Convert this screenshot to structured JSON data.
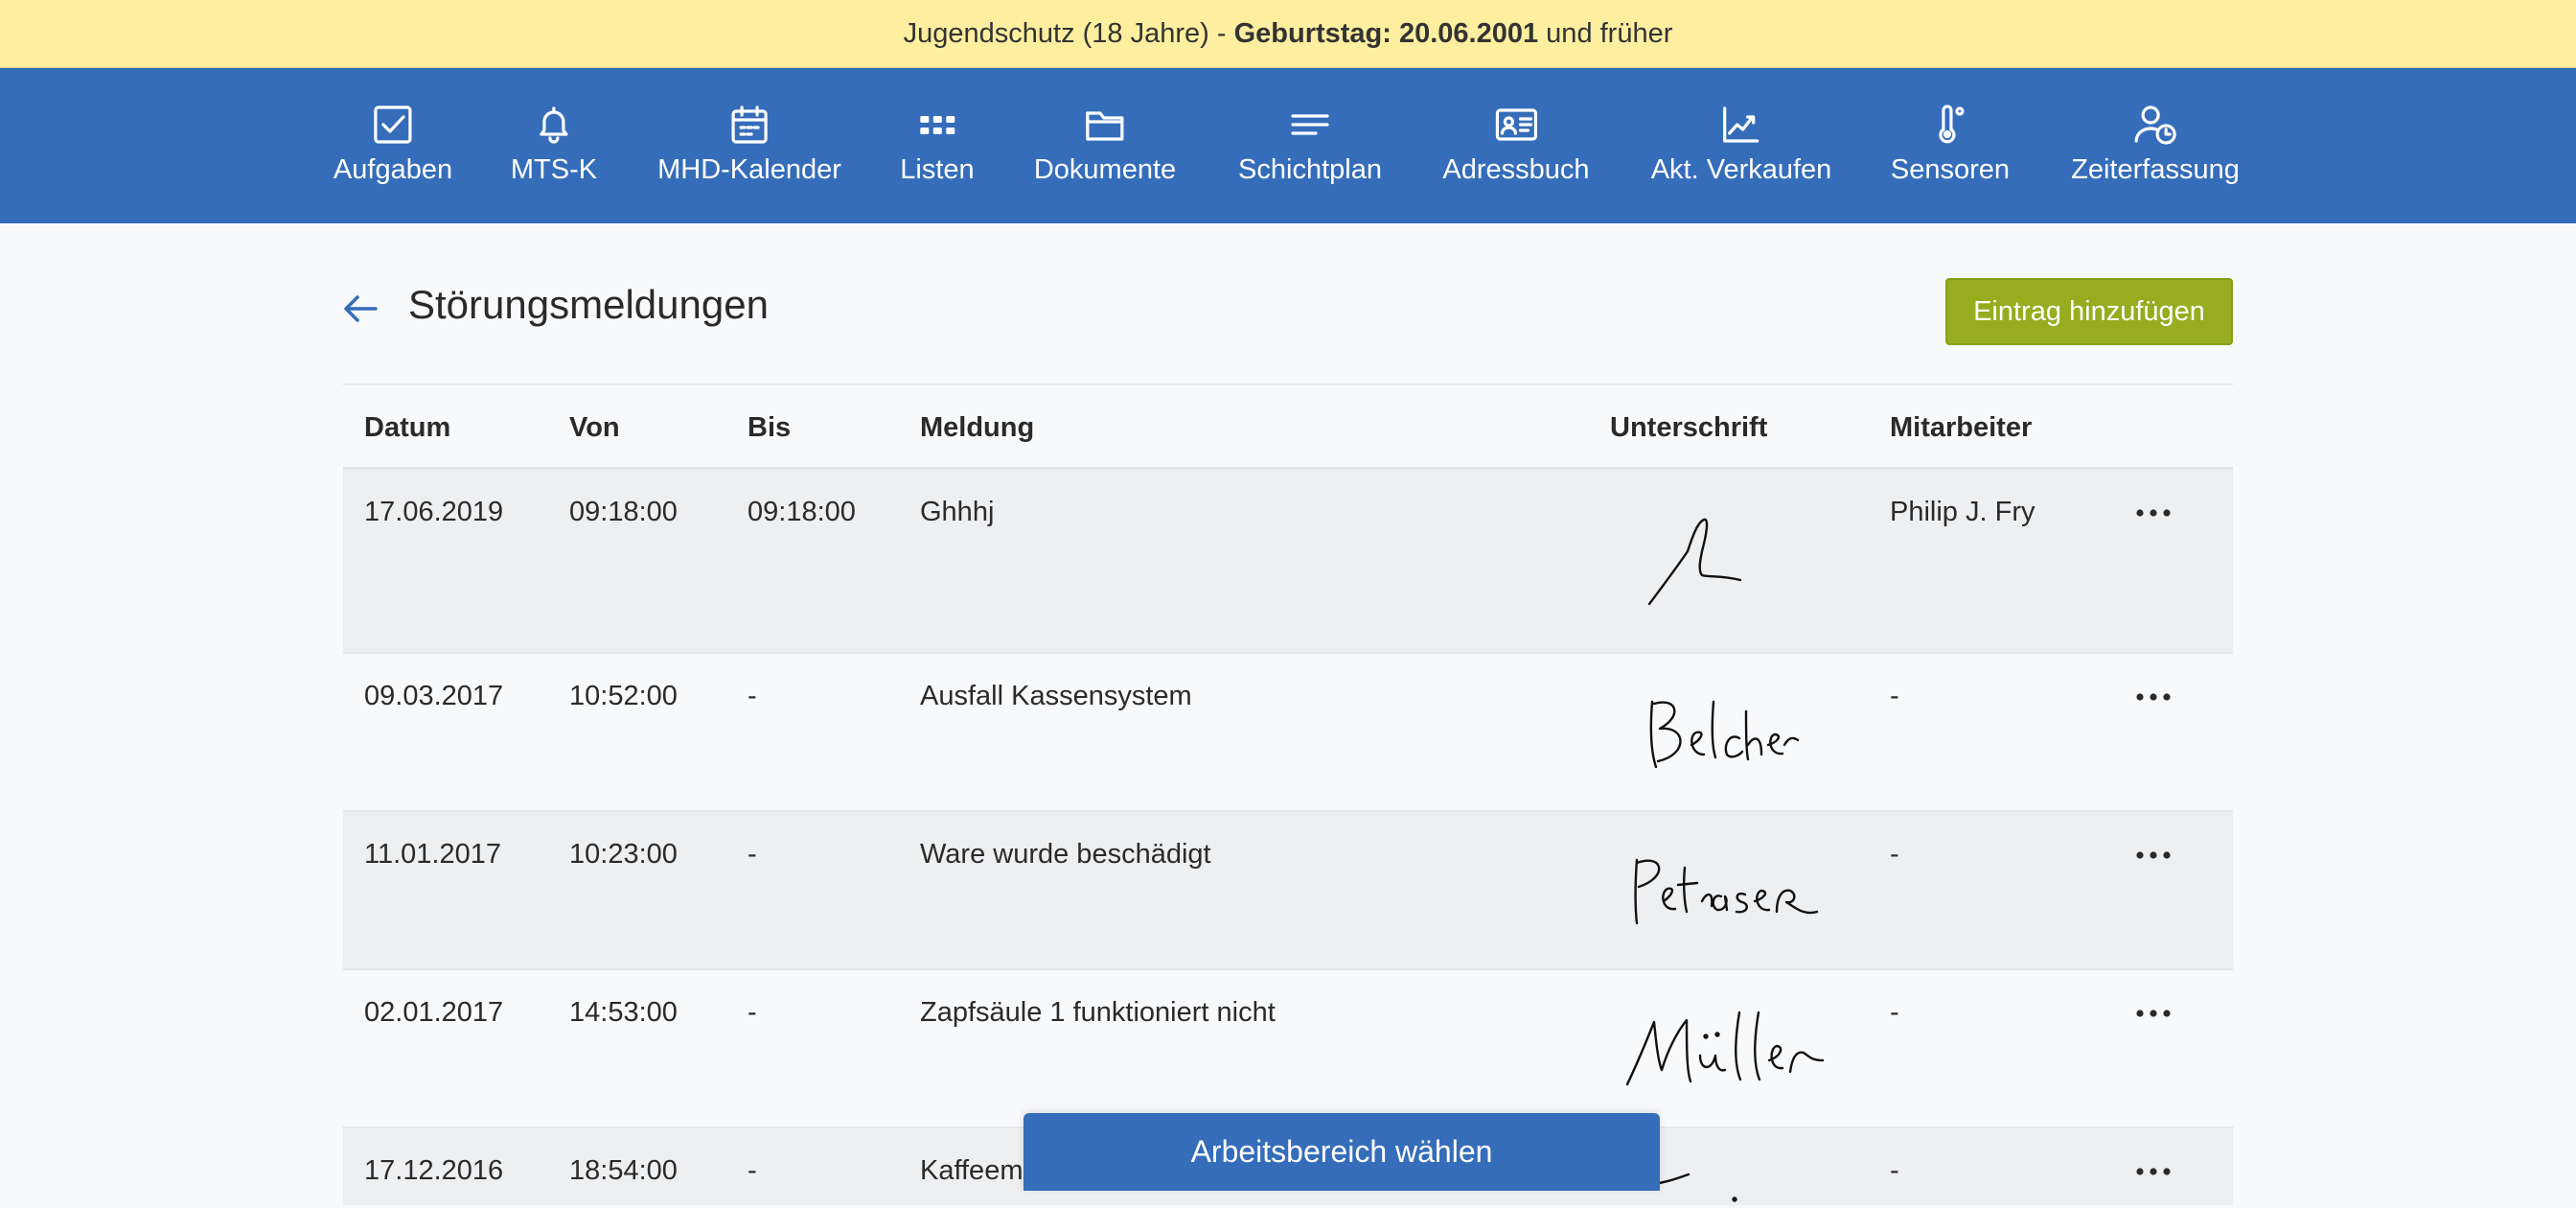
{
  "banner": {
    "prefix": "Jugendschutz (18 Jahre) - ",
    "bold": "Geburtstag: 20.06.2001",
    "suffix": " und früher"
  },
  "nav": [
    {
      "label": "Aufgaben",
      "icon": "checkbox-icon"
    },
    {
      "label": "MTS-K",
      "icon": "bell-icon"
    },
    {
      "label": "MHD-Kalender",
      "icon": "calendar-icon"
    },
    {
      "label": "Listen",
      "icon": "grid-icon"
    },
    {
      "label": "Dokumente",
      "icon": "folder-icon"
    },
    {
      "label": "Schichtplan",
      "icon": "lines-icon"
    },
    {
      "label": "Adressbuch",
      "icon": "contact-card-icon"
    },
    {
      "label": "Akt. Verkaufen",
      "icon": "chart-icon"
    },
    {
      "label": "Sensoren",
      "icon": "thermometer-icon"
    },
    {
      "label": "Zeiterfassung",
      "icon": "user-clock-icon"
    }
  ],
  "page": {
    "title": "Störungsmeldungen",
    "add_button": "Eintrag hinzufügen"
  },
  "table": {
    "headers": {
      "datum": "Datum",
      "von": "Von",
      "bis": "Bis",
      "meldung": "Meldung",
      "unterschrift": "Unterschrift",
      "mitarbeiter": "Mitarbeiter"
    },
    "rows": [
      {
        "datum": "17.06.2019",
        "von": "09:18:00",
        "bis": "09:18:00",
        "meldung": "Ghhhj",
        "mitarbeiter": "Philip J. Fry"
      },
      {
        "datum": "09.03.2017",
        "von": "10:52:00",
        "bis": "-",
        "meldung": "Ausfall Kassensystem",
        "mitarbeiter": "-"
      },
      {
        "datum": "11.01.2017",
        "von": "10:23:00",
        "bis": "-",
        "meldung": "Ware wurde beschädigt",
        "mitarbeiter": "-"
      },
      {
        "datum": "02.01.2017",
        "von": "14:53:00",
        "bis": "-",
        "meldung": "Zapfsäule 1 funktioniert nicht",
        "mitarbeiter": "-"
      },
      {
        "datum": "17.12.2016",
        "von": "18:54:00",
        "bis": "-",
        "meldung": "Kaffeem",
        "mitarbeiter": "-"
      }
    ]
  },
  "workspace_button": "Arbeitsbereich wählen",
  "colors": {
    "banner": "#fdef9f",
    "nav": "#356dba",
    "add_button": "#97ac1e",
    "row_shade": "#eeeff1"
  }
}
